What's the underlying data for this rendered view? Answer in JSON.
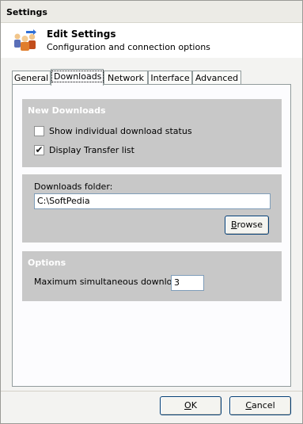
{
  "window": {
    "title": "Settings"
  },
  "header": {
    "title": "Edit Settings",
    "subtitle": "Configuration and connection options",
    "icon": "settings-people-icon"
  },
  "tabs": [
    {
      "label": "General",
      "active": false
    },
    {
      "label": "Downloads",
      "active": true
    },
    {
      "label": "Network",
      "active": false
    },
    {
      "label": "Interface",
      "active": false
    },
    {
      "label": "Advanced",
      "active": false
    }
  ],
  "new_downloads": {
    "title": "New Downloads",
    "options": [
      {
        "label": "Show individual download status",
        "checked": false
      },
      {
        "label": "Display Transfer list",
        "checked": true
      }
    ]
  },
  "folder": {
    "label": "Downloads folder:",
    "value": "C:\\SoftPedia",
    "browse_label": "Browse",
    "browse_mnemonic": "B",
    "browse_rest": "rowse"
  },
  "options": {
    "title": "Options",
    "max_label": "Maximum simultaneous downloads:",
    "max_value": "3"
  },
  "footer": {
    "ok_label": "OK",
    "ok_mnemonic": "O",
    "ok_rest": "K",
    "cancel_label": "Cancel",
    "cancel_mnemonic": "C",
    "cancel_rest": "ancel"
  },
  "colors": {
    "group_background": "#c8c8c8",
    "group_title": "#ffffff",
    "panel_background": "#fcfcfe"
  }
}
